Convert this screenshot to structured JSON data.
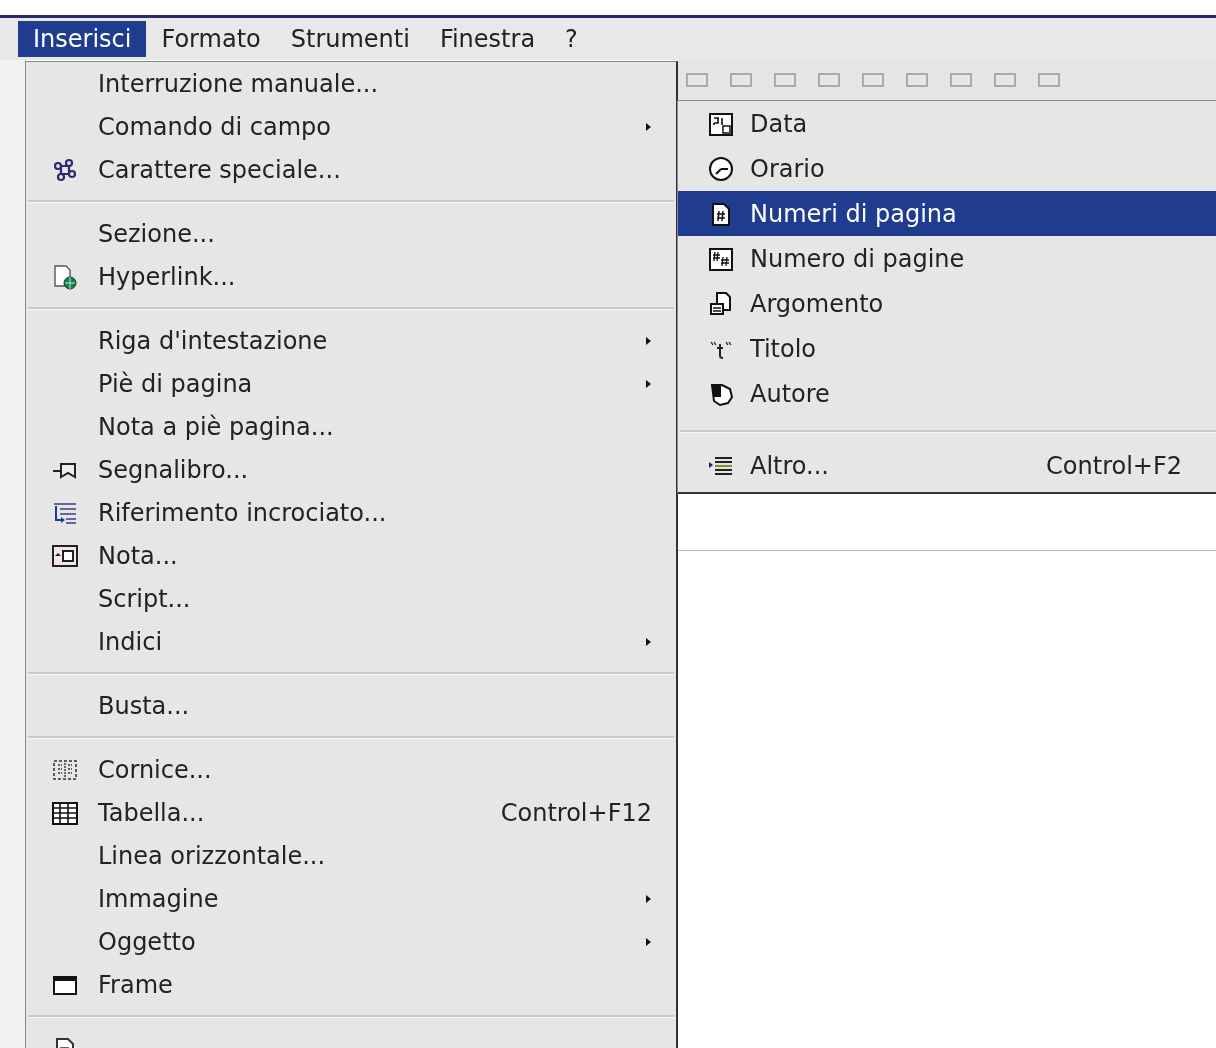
{
  "menubar": [
    {
      "label": "Inserisci",
      "selected": true
    },
    {
      "label": "Formato",
      "selected": false
    },
    {
      "label": "Strumenti",
      "selected": false
    },
    {
      "label": "Finestra",
      "selected": false
    },
    {
      "label": "?",
      "selected": false
    }
  ],
  "insert_menu": [
    {
      "kind": "item",
      "label": "Interruzione manuale...",
      "submenu": false
    },
    {
      "kind": "item",
      "label": "Comando di campo",
      "submenu": true
    },
    {
      "kind": "item",
      "label": "Carattere speciale...",
      "submenu": false
    },
    {
      "kind": "separator"
    },
    {
      "kind": "item",
      "label": "Sezione...",
      "submenu": false
    },
    {
      "kind": "item",
      "label": "Hyperlink...",
      "submenu": false
    },
    {
      "kind": "separator"
    },
    {
      "kind": "item",
      "label": "Riga d'intestazione",
      "submenu": true
    },
    {
      "kind": "item",
      "label": "Piè di pagina",
      "submenu": true
    },
    {
      "kind": "item",
      "label": "Nota a piè pagina...",
      "submenu": false
    },
    {
      "kind": "item",
      "label": "Segnalibro...",
      "submenu": false
    },
    {
      "kind": "item",
      "label": "Riferimento incrociato...",
      "submenu": false
    },
    {
      "kind": "item",
      "label": "Nota...",
      "submenu": false
    },
    {
      "kind": "item",
      "label": "Script...",
      "submenu": false
    },
    {
      "kind": "item",
      "label": "Indici",
      "submenu": true
    },
    {
      "kind": "separator"
    },
    {
      "kind": "item",
      "label": "Busta...",
      "submenu": false
    },
    {
      "kind": "separator"
    },
    {
      "kind": "item",
      "label": "Cornice...",
      "submenu": false
    },
    {
      "kind": "item",
      "label": "Tabella...",
      "shortcut": "Control+F12",
      "submenu": false
    },
    {
      "kind": "item",
      "label": "Linea orizzontale...",
      "submenu": false
    },
    {
      "kind": "item",
      "label": "Immagine",
      "submenu": true
    },
    {
      "kind": "item",
      "label": "Oggetto",
      "submenu": true
    },
    {
      "kind": "item",
      "label": "Frame",
      "submenu": false
    },
    {
      "kind": "separator"
    },
    {
      "kind": "item"
    }
  ],
  "field_submenu": [
    {
      "kind": "item",
      "label": "Data",
      "selected": false
    },
    {
      "kind": "item",
      "label": "Orario",
      "selected": false
    },
    {
      "kind": "item",
      "label": "Numeri di pagina",
      "selected": true
    },
    {
      "kind": "item",
      "label": "Numero di pagine",
      "selected": false
    },
    {
      "kind": "item",
      "label": "Argomento",
      "selected": false
    },
    {
      "kind": "item",
      "label": "Titolo",
      "selected": false
    },
    {
      "kind": "item",
      "label": "Autore",
      "selected": false
    },
    {
      "kind": "separator"
    },
    {
      "kind": "item",
      "label": "Altro...",
      "shortcut": "Control+F2",
      "selected": false
    }
  ]
}
